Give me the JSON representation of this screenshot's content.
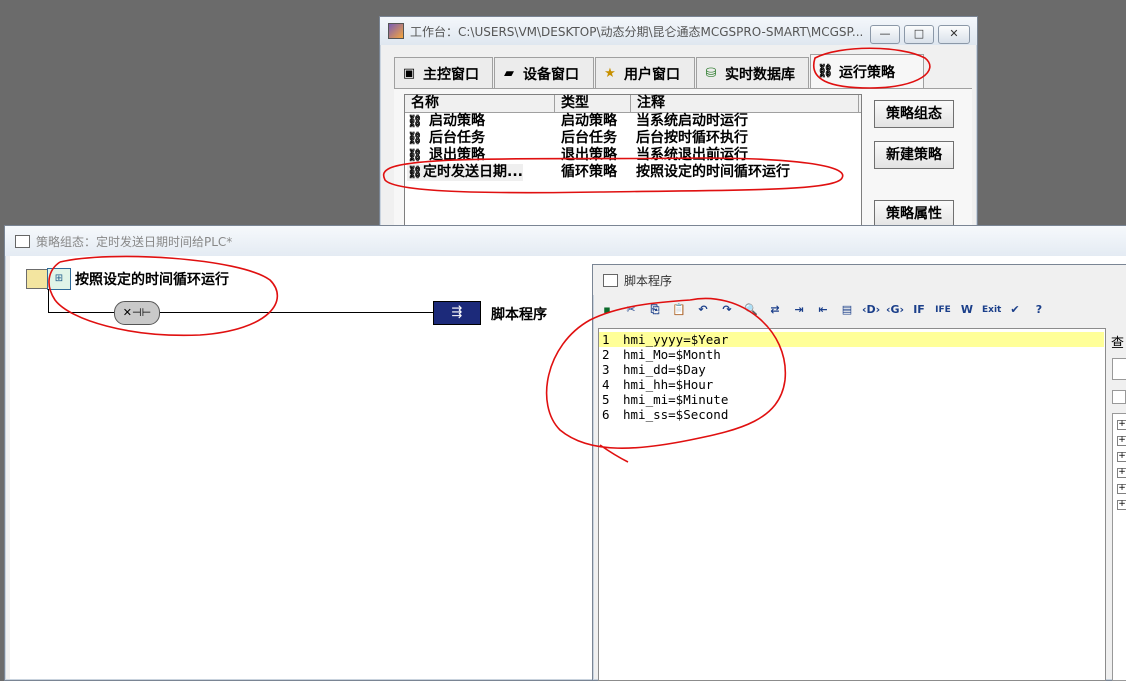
{
  "workbench": {
    "title": "工作台：C:\\USERS\\VM\\DESKTOP\\动态分期\\昆仑通态MCGSPRO-SMART\\MCGSP...",
    "min_label": "—",
    "max_label": "□",
    "close_label": "✕",
    "tabs": [
      {
        "label": "主控窗口",
        "icon": "window-icon"
      },
      {
        "label": "设备窗口",
        "icon": "device-icon"
      },
      {
        "label": "用户窗口",
        "icon": "user-window-icon"
      },
      {
        "label": "实时数据库",
        "icon": "database-icon"
      },
      {
        "label": "运行策略",
        "icon": "strategy-icon"
      }
    ],
    "columns": [
      "名称",
      "类型",
      "注释"
    ],
    "rows": [
      {
        "name": "启动策略",
        "type": "启动策略",
        "note": "当系统启动时运行"
      },
      {
        "name": "后台任务",
        "type": "后台任务",
        "note": "后台按时循环执行"
      },
      {
        "name": "退出策略",
        "type": "退出策略",
        "note": "当系统退出前运行"
      },
      {
        "name": "定时发送日期...",
        "type": "循环策略",
        "note": "按照设定的时间循环运行"
      }
    ],
    "buttons": {
      "compose": "策略组态",
      "new": "新建策略",
      "properties": "策略属性"
    }
  },
  "strategy_window": {
    "title": "策略组态：定时发送日期时间给PLC*",
    "strategy_label": "按照设定的时间循环运行",
    "script_block_label": "脚本程序"
  },
  "script_window": {
    "title": "脚本程序",
    "side_label": "查",
    "code": [
      {
        "n": "1",
        "text": "hmi_yyyy=$Year"
      },
      {
        "n": "2",
        "text": "hmi_Mo=$Month"
      },
      {
        "n": "3",
        "text": "hmi_dd=$Day"
      },
      {
        "n": "4",
        "text": "hmi_hh=$Hour"
      },
      {
        "n": "5",
        "text": "hmi_mi=$Minute"
      },
      {
        "n": "6",
        "text": "hmi_ss=$Second"
      }
    ],
    "toolbar_icons": [
      "save-icon",
      "cut-icon",
      "copy-icon",
      "paste-icon",
      "undo-icon",
      "redo-icon",
      "find-icon",
      "replace-icon",
      "indent-icon",
      "outdent-icon",
      "comment-icon",
      "insert-d-icon",
      "insert-g-icon",
      "if-icon",
      "if-else-icon",
      "while-icon",
      "exit-icon",
      "check-icon",
      "help-icon"
    ],
    "toolbar_glyphs": [
      "▪",
      "✂",
      "⎘",
      "📋",
      "↶",
      "↷",
      "🔍",
      "⇄",
      "⇥",
      "⇤",
      "▤",
      "‹D›",
      "‹G›",
      "IF",
      "IFE",
      "W",
      "Exit",
      "✔",
      "?"
    ]
  },
  "colors": {
    "highlight_line": "#ffff99",
    "script_block": "#1c2a7a",
    "annotation": "#e01010"
  }
}
